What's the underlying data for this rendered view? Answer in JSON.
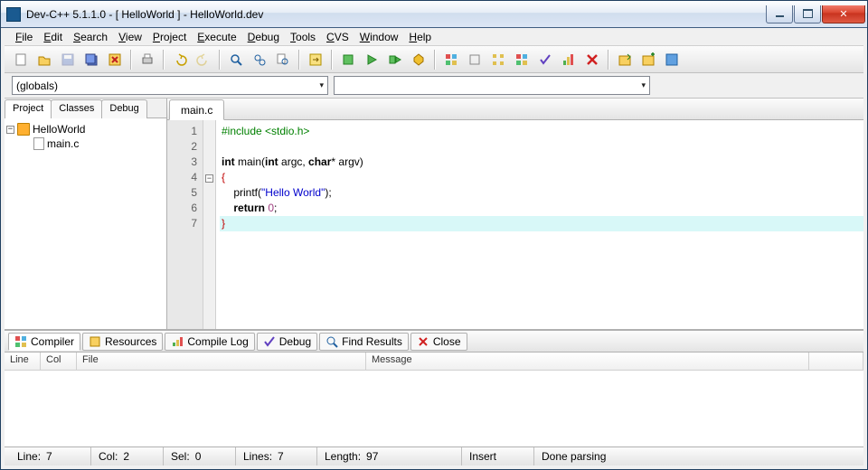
{
  "title": "Dev-C++ 5.1.1.0 - [ HelloWorld ] - HelloWorld.dev",
  "menu": [
    "File",
    "Edit",
    "Search",
    "View",
    "Project",
    "Execute",
    "Debug",
    "Tools",
    "CVS",
    "Window",
    "Help"
  ],
  "globals_combo": "(globals)",
  "left_tabs": [
    "Project",
    "Classes",
    "Debug"
  ],
  "tree": {
    "root": "HelloWorld",
    "child": "main.c"
  },
  "editor_tab": "main.c",
  "code": {
    "lines": [
      {
        "n": 1,
        "html": "<span class='pp'>#include &lt;stdio.h&gt;</span>"
      },
      {
        "n": 2,
        "html": ""
      },
      {
        "n": 3,
        "html": "<span class='ty'>int</span> main(<span class='ty'>int</span> argc, <span class='ty'>char</span>* argv)"
      },
      {
        "n": 4,
        "html": "<span class='br'>{</span>",
        "fold": true
      },
      {
        "n": 5,
        "html": "    printf(<span class='str'>\"Hello World\"</span>);"
      },
      {
        "n": 6,
        "html": "    <span class='kw'>return</span> <span class='num'>0</span>;"
      },
      {
        "n": 7,
        "html": "<span class='br'>}</span>",
        "hl": true
      }
    ]
  },
  "bottom_tabs": [
    "Compiler",
    "Resources",
    "Compile Log",
    "Debug",
    "Find Results",
    "Close"
  ],
  "bottom_headers": {
    "line": "Line",
    "col": "Col",
    "file": "File",
    "message": "Message"
  },
  "status": {
    "line_lbl": "Line:",
    "line": "7",
    "col_lbl": "Col:",
    "col": "2",
    "sel_lbl": "Sel:",
    "sel": "0",
    "lines_lbl": "Lines:",
    "lines": "7",
    "len_lbl": "Length:",
    "len": "97",
    "mode": "Insert",
    "msg": "Done parsing"
  }
}
